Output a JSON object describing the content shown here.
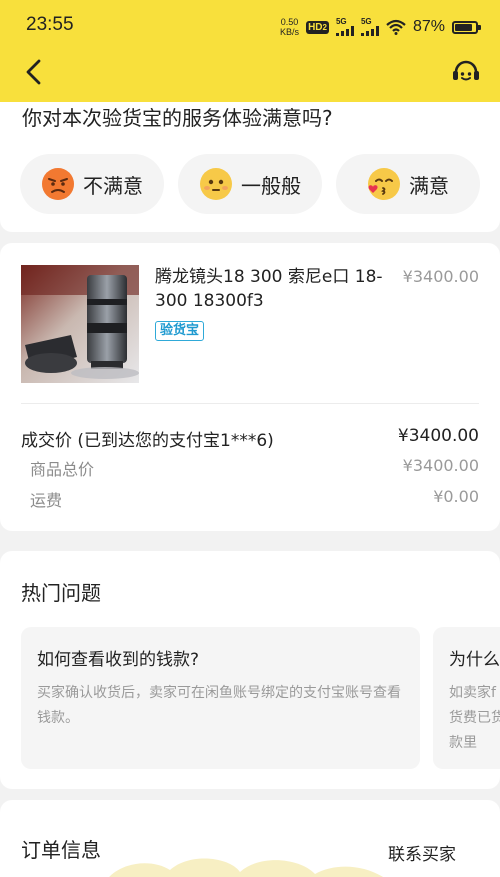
{
  "status_bar": {
    "time": "23:55",
    "net_speed_value": "0.50",
    "net_speed_unit": "KB/s",
    "hd_label": "HD",
    "hd_sub": "2",
    "sig1_label": "5G",
    "sig2_label": "5G",
    "battery": "87%"
  },
  "header": {
    "back_icon": "chevron-left-icon",
    "service_icon": "customer-service-icon",
    "accent_color": "#f8e03c"
  },
  "satisfaction": {
    "question": "你对本次验货宝的服务体验满意吗?",
    "options": [
      {
        "label": "不满意",
        "icon": "angry-face-icon"
      },
      {
        "label": "一般般",
        "icon": "neutral-face-icon"
      },
      {
        "label": "满意",
        "icon": "kiss-face-icon"
      }
    ]
  },
  "product": {
    "title": "腾龙镜头18 300 索尼e口 18-300 18300f3",
    "price": "¥3400.00",
    "badge": "验货宝"
  },
  "prices": {
    "deal_label": "成交价 (已到达您的支付宝1***6)",
    "deal_value": "¥3400.00",
    "total_label": "商品总价",
    "total_value": "¥3400.00",
    "shipping_label": "运费",
    "shipping_value": "¥0.00"
  },
  "faq": {
    "title": "热门问题",
    "items": [
      {
        "question": "如何查看收到的钱款?",
        "answer": "买家确认收货后，卖家可在闲鱼账号绑定的支付宝账号查看钱款。"
      },
      {
        "question": "为什么",
        "answer": "如卖家f货费已货款里"
      }
    ]
  },
  "order": {
    "title": "订单信息",
    "contact_button": "联系买家"
  }
}
